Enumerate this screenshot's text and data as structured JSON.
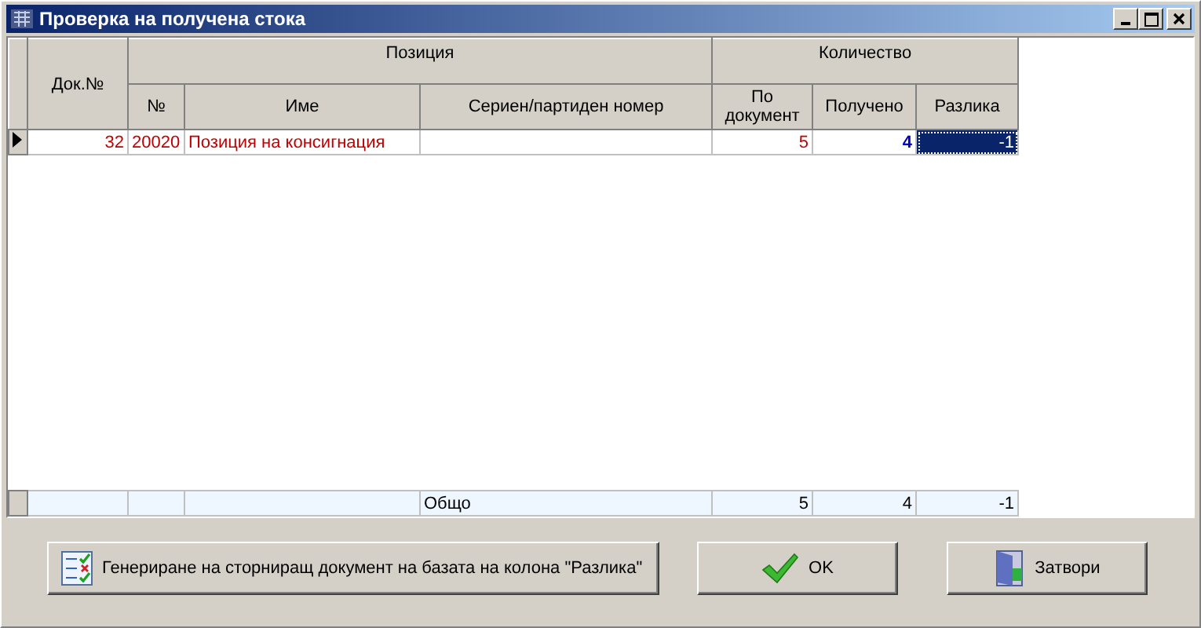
{
  "window": {
    "title": "Проверка на получена стока"
  },
  "table": {
    "headers": {
      "doc": "Док.№",
      "position": "Позиция",
      "quantity": "Количество",
      "columns": [
        "№",
        "Име",
        "Сериен/партиден номер",
        "По документ",
        "Получено",
        "Разлика"
      ]
    },
    "rows": [
      {
        "selected": true,
        "difference_focused": true,
        "doc": "32",
        "number": "20020",
        "name": "Позиция на консигнация",
        "by_document": "5",
        "received": "4",
        "difference": "-1"
      }
    ],
    "footer": {
      "label": "Общо",
      "by_document": "5",
      "received": "4",
      "difference": "-1"
    }
  },
  "buttons": [
    {
      "kind": "generate",
      "label": "Генериране на сторниращ документ на базата на колона \"Разлика\""
    },
    {
      "kind": "ok",
      "label": "OK"
    },
    {
      "kind": "close",
      "label": "Затвори"
    }
  ]
}
